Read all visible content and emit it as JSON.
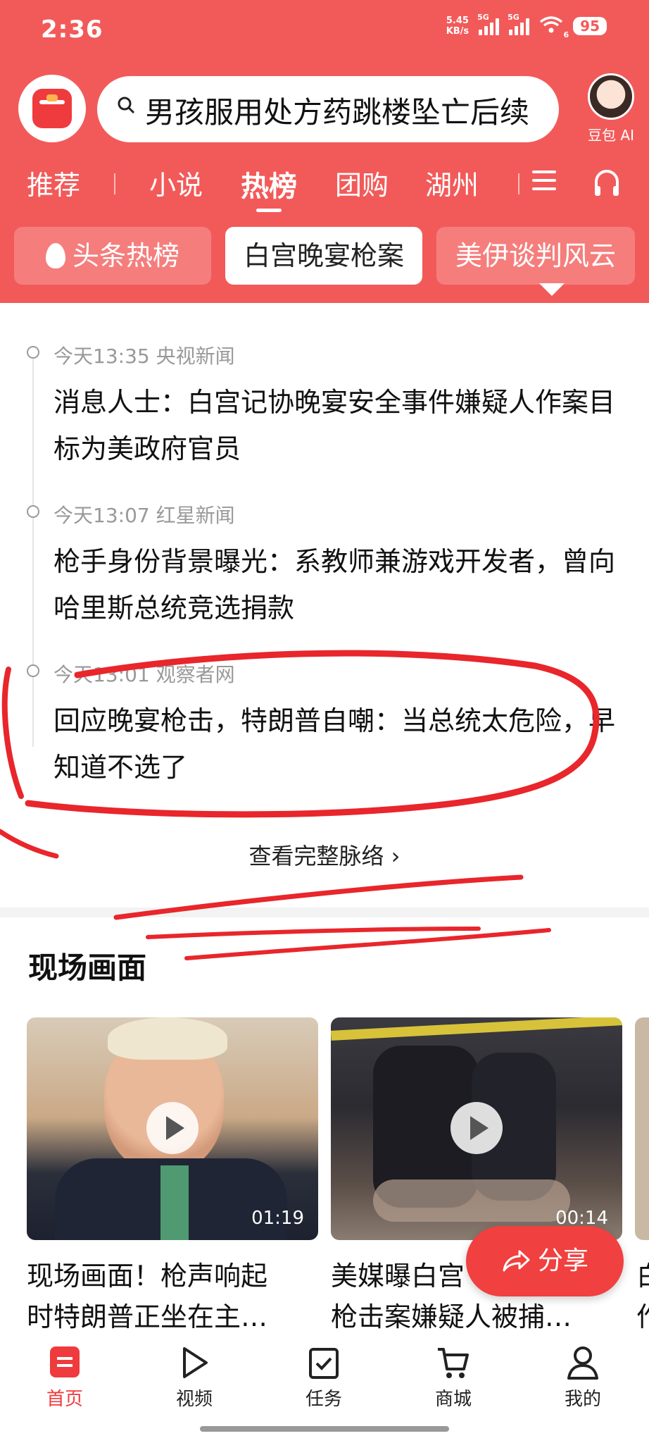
{
  "status_bar": {
    "time": "2:36",
    "net_speed_value": "5.45",
    "net_speed_unit": "KB/s",
    "signal1_tag": "5G",
    "signal2_tag": "5G",
    "wifi_tag": "6",
    "battery": "95"
  },
  "header": {
    "search_query": "男孩服用处方药跳楼坠亡后续",
    "ai_label": "豆包 AI",
    "tabs": [
      {
        "label": "推荐"
      },
      {
        "label": "小说"
      },
      {
        "label": "热榜"
      },
      {
        "label": "团购"
      },
      {
        "label": "湖州"
      }
    ],
    "active_tab": "热榜",
    "chips": [
      {
        "label": "头条热榜"
      },
      {
        "label": "白宫晚宴枪案"
      },
      {
        "label": "美伊谈判风云"
      }
    ]
  },
  "timeline": [
    {
      "meta": "今天13:35 央视新闻",
      "title": "消息人士：白宫记协晚宴安全事件嫌疑人作案目标为美政府官员"
    },
    {
      "meta": "今天13:07 红星新闻",
      "title": "枪手身份背景曝光：系教师兼游戏开发者，曾向哈里斯总统竞选捐款"
    },
    {
      "meta": "今天13:01 观察者网",
      "title": "回应晚宴枪击，特朗普自嘲：当总统太危险，早知道不选了"
    }
  ],
  "more_link": "查看完整脉络 ›",
  "live_section": {
    "title": "现场画面",
    "videos": [
      {
        "duration": "01:19",
        "title_line1": "现场画面！枪声响起",
        "title_line2": "时特朗普正坐在主…"
      },
      {
        "duration": "00:14",
        "title_line1": "美媒曝白宫",
        "title_line2": "枪击案嫌疑人被捕…"
      }
    ],
    "third_partial": {
      "line1": "白",
      "line2": "作"
    }
  },
  "share_button": "分享",
  "bottom_nav": [
    {
      "label": "首页",
      "icon": "home-icon"
    },
    {
      "label": "视频",
      "icon": "video-play-icon"
    },
    {
      "label": "任务",
      "icon": "task-check-icon"
    },
    {
      "label": "商城",
      "icon": "cart-icon"
    },
    {
      "label": "我的",
      "icon": "profile-icon"
    }
  ],
  "colors": {
    "brand": "#f25a59",
    "annotation": "#e8262b"
  }
}
